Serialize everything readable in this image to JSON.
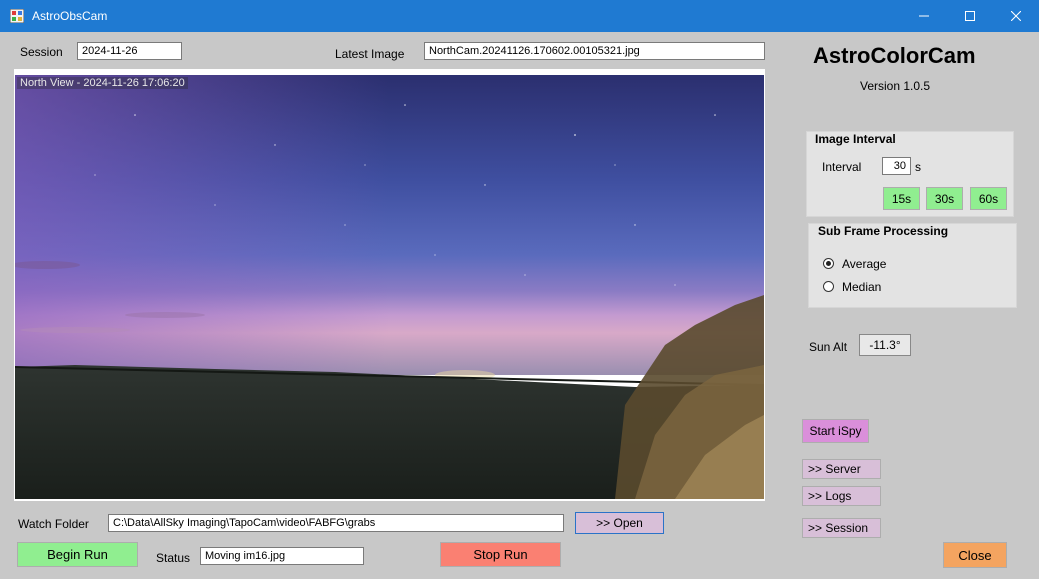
{
  "window": {
    "title": "AstroObsCam"
  },
  "session": {
    "label": "Session",
    "value": "2024-11-26"
  },
  "latest_image": {
    "label": "Latest Image",
    "value": "NorthCam.20241126.170602.00105321.jpg"
  },
  "preview": {
    "overlay": "North View - 2024-11-26 17:06:20"
  },
  "app": {
    "name": "AstroColorCam",
    "version": "Version  1.0.5"
  },
  "image_interval": {
    "title": "Image Interval",
    "interval_label": "Interval",
    "interval_value": "30",
    "unit": "s",
    "presets": [
      "15s",
      "30s",
      "60s"
    ]
  },
  "sub_frame": {
    "title": "Sub Frame Processing",
    "options": [
      "Average",
      "Median"
    ],
    "selected": "Average"
  },
  "sun_alt": {
    "label": "Sun Alt",
    "value": "-11.3°"
  },
  "buttons": {
    "start_ispy": "Start iSpy",
    "server": ">> Server",
    "logs": ">> Logs",
    "session": ">> Session",
    "close": "Close",
    "open": ">> Open",
    "begin_run": "Begin Run",
    "stop_run": "Stop Run"
  },
  "watch_folder": {
    "label": "Watch Folder",
    "value": "C:\\Data\\AllSky Imaging\\TapoCam\\video\\FABFG\\grabs"
  },
  "status": {
    "label": "Status",
    "value": "Moving im16.jpg"
  },
  "colors": {
    "titlebar": "#1f7ad2",
    "green_button": "#90ee90",
    "pink_button": "#da8fda",
    "thistle_button": "#d8bfd8",
    "salmon_button": "#fa8072",
    "orange_button": "#f4a460"
  }
}
